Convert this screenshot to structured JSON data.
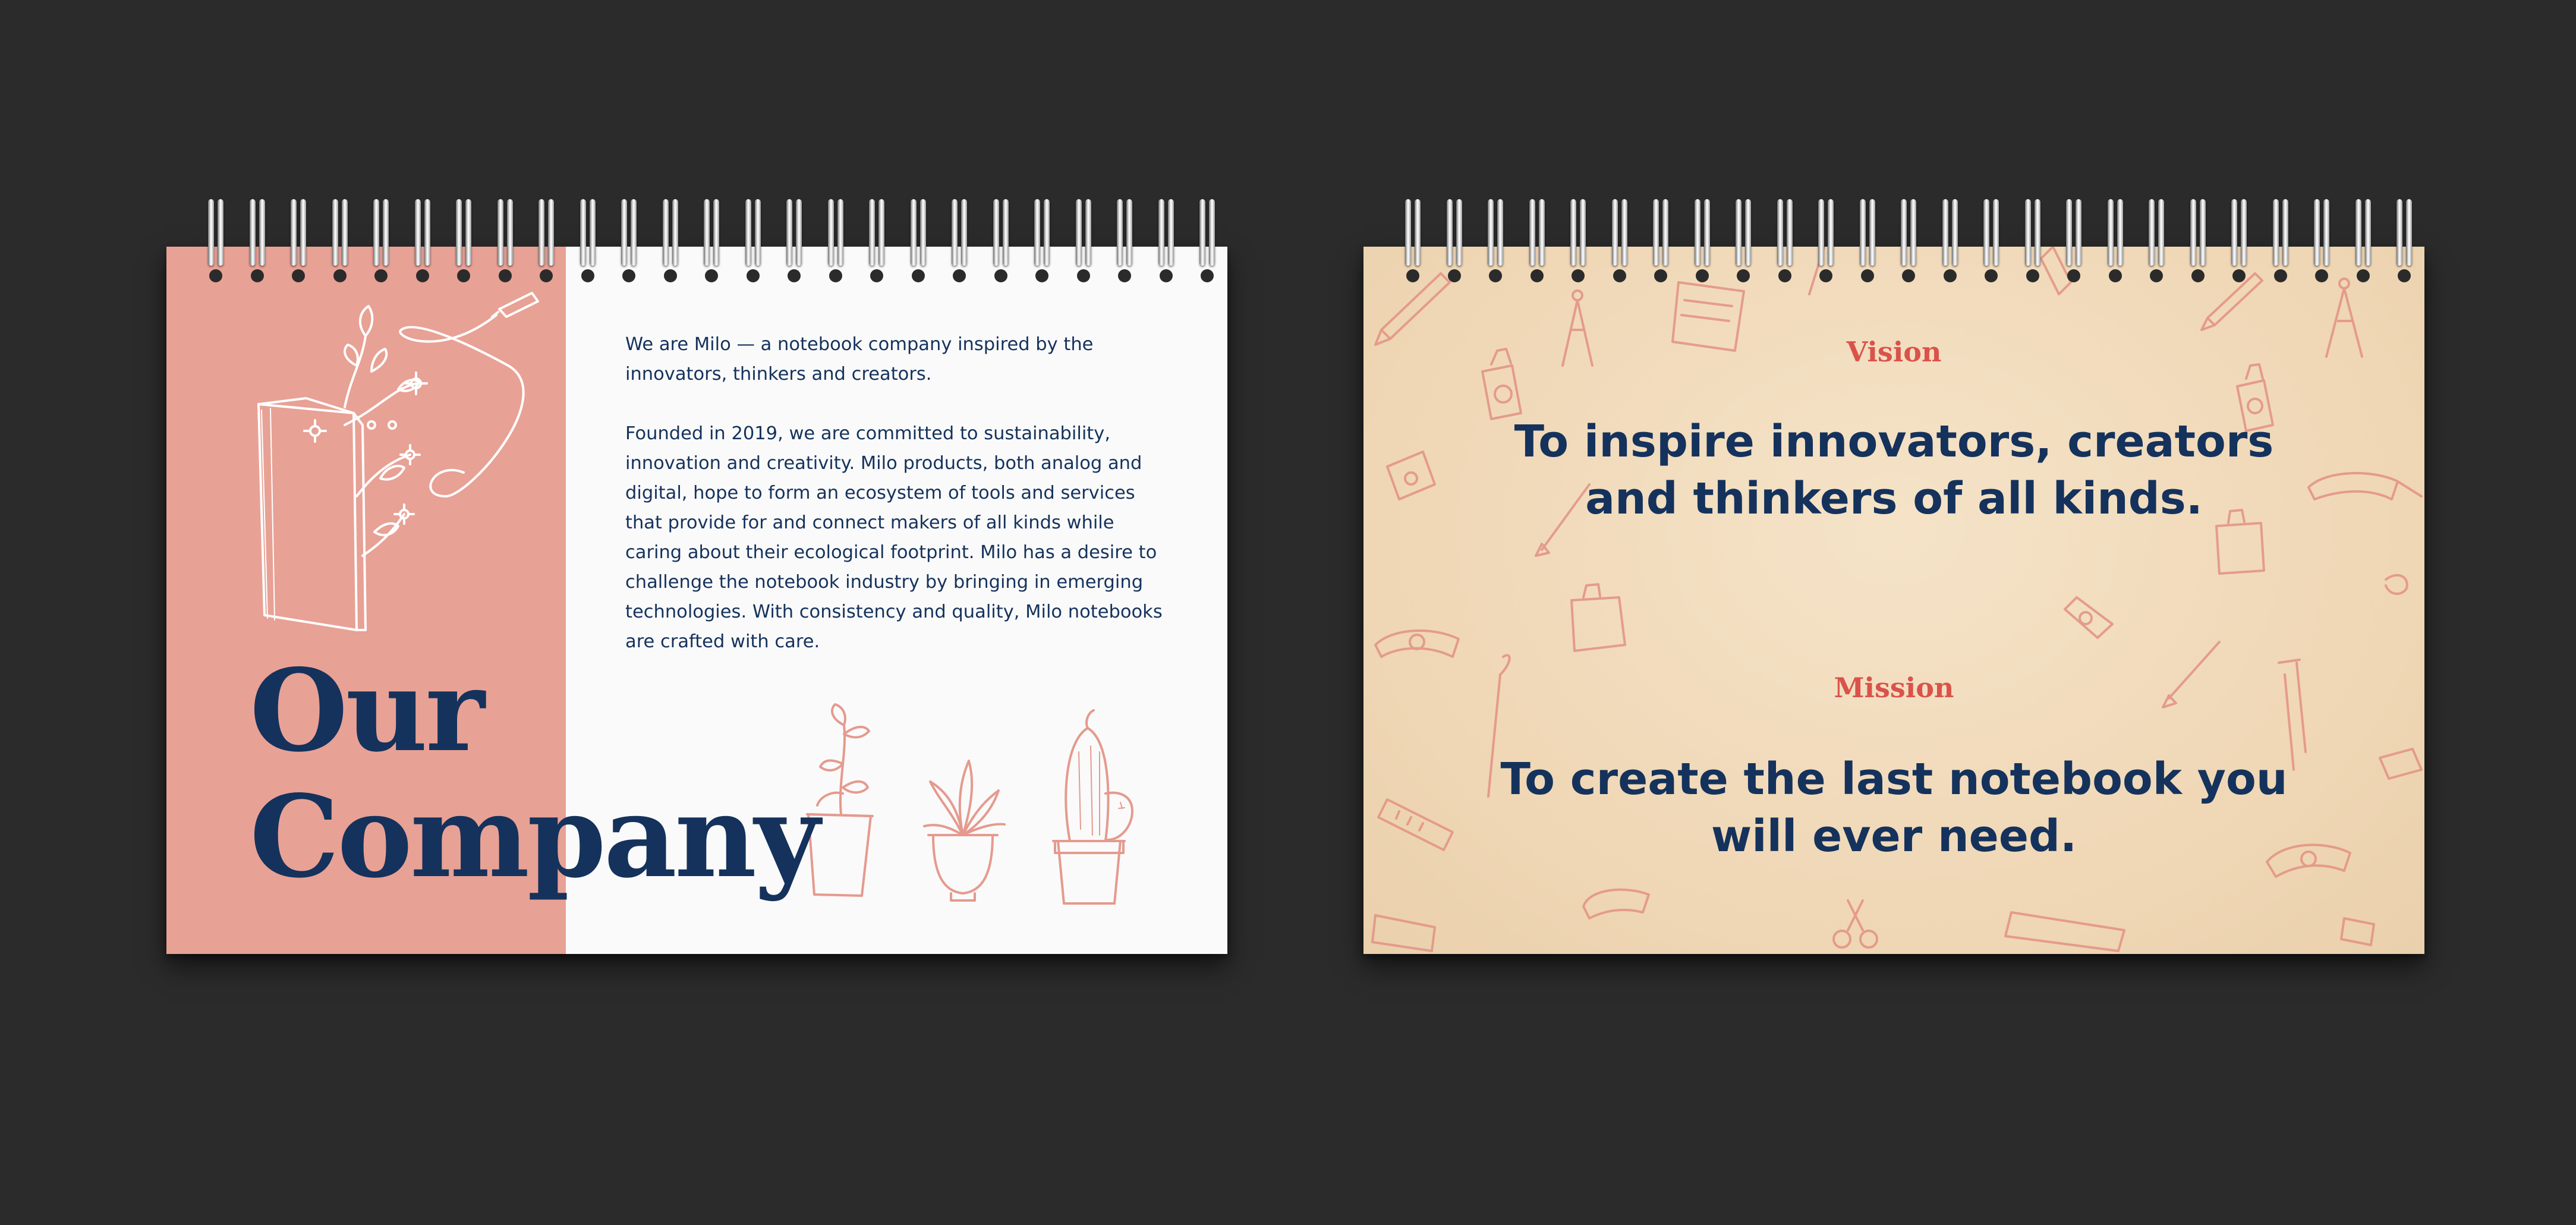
{
  "left_page": {
    "intro": "We are Milo — a notebook company inspired by the innovators, thinkers and creators.",
    "body": "Founded in 2019, we are committed to sustainability, innovation and creativity. Milo products, both analog and digital, hope to form an ecosystem of tools and services that provide for and connect makers of all kinds while caring about their ecological footprint. Milo has a desire to challenge the notebook industry by bringing in emerging technologies. With consistency and quality, Milo notebooks are crafted with care.",
    "title_line1": "Our",
    "title_line2": "Company",
    "illustrations": [
      "book-flowers-illustration",
      "plant-pots-illustration"
    ]
  },
  "right_page": {
    "vision_label": "Vision",
    "vision_text": "To inspire innovators, creators and thinkers of all kinds.",
    "mission_label": "Mission",
    "mission_text": "To create the last notebook you will ever need.",
    "pattern": "stationery-doodle-pattern"
  },
  "colors": {
    "background": "#2b2b2b",
    "pink": "#e8a195",
    "navy": "#14325c",
    "red": "#d9534a",
    "kraft": "#efd6b4",
    "paper": "#fafafa"
  }
}
